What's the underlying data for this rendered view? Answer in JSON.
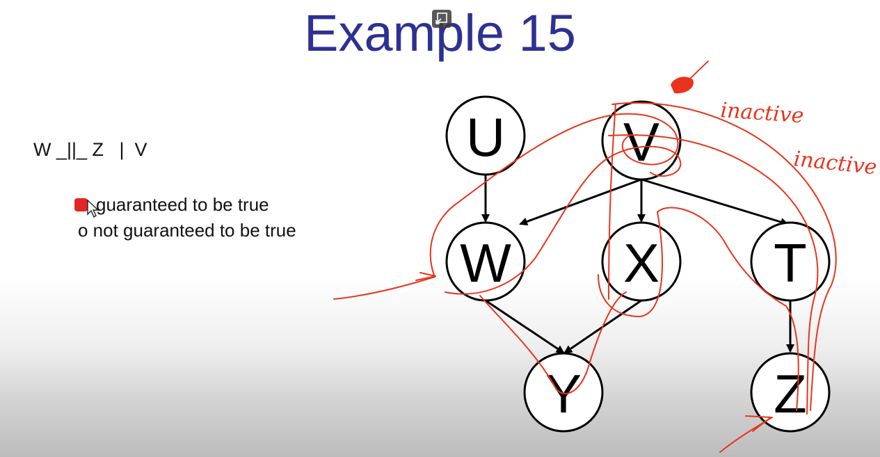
{
  "slide": {
    "title": "Example 15",
    "statement": "W _||_ Z   |  V",
    "options": [
      {
        "label": "guaranteed to be true",
        "selected": true
      },
      {
        "label": "o not guaranteed to be true",
        "selected": false
      }
    ]
  },
  "diagram": {
    "nodes": [
      "U",
      "V",
      "W",
      "X",
      "T",
      "Y",
      "Z"
    ],
    "edges": [
      [
        "U",
        "W"
      ],
      [
        "V",
        "W"
      ],
      [
        "V",
        "X"
      ],
      [
        "V",
        "T"
      ],
      [
        "W",
        "Y"
      ],
      [
        "X",
        "Y"
      ],
      [
        "T",
        "Z"
      ]
    ]
  },
  "annotations": {
    "label1": "inactive",
    "label2": "inactive",
    "ink_color": "#e8341c"
  },
  "colors": {
    "title": "#2e3192",
    "selection": "#e52424"
  }
}
